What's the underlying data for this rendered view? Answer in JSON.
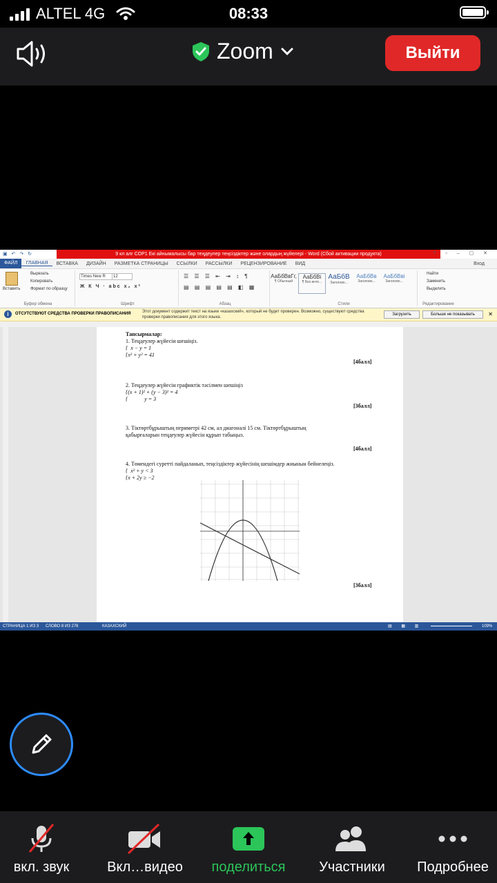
{
  "status": {
    "carrier": "ALTEL 4G",
    "time": "08:33"
  },
  "zoom": {
    "title": "Zoom",
    "leave_label": "Выйти"
  },
  "word": {
    "window_title": "9 кл алг  СОР1 Екі айнымалысы бар теңдеулер теңсіздіктер және олардың жүйелері - Word (Сбой активации продукта)",
    "file_tab": "ФАЙЛ",
    "tabs": [
      "ГЛАВНАЯ",
      "ВСТАВКА",
      "ДИЗАЙН",
      "РАЗМЕТКА СТРАНИЦЫ",
      "ССЫЛКИ",
      "РАССЫЛКИ",
      "РЕЦЕНЗИРОВАНИЕ",
      "ВИД"
    ],
    "login": "Вход",
    "clipboard": {
      "paste": "Вставить",
      "cut": "Вырезать",
      "copy": "Копировать",
      "format": "Формат по образцу",
      "group": "Буфер обмена"
    },
    "font": {
      "name": "Times New R",
      "size": "12",
      "group": "Шрифт"
    },
    "paragraph_group": "Абзац",
    "styles": [
      {
        "sample": "АаБбВвГг,",
        "name": "¶ Обычный"
      },
      {
        "sample": "АаБбВі",
        "name": "¶ Без инте..."
      },
      {
        "sample": "АаБбВ",
        "name": "Заголово..."
      },
      {
        "sample": "АаБбВв",
        "name": "Заголово..."
      },
      {
        "sample": "АаБбВві",
        "name": "Заголово..."
      }
    ],
    "styles_group": "Стили",
    "editing": {
      "find": "Найти",
      "replace": "Заменить",
      "select": "Выделить",
      "group": "Редактирование"
    },
    "infobar": {
      "title": "ОТСУТСТВУЮТ СРЕДСТВА ПРОВЕРКИ ПРАВОПИСАНИЯ",
      "message": "Этот документ содержит текст на языке «казахский», который не будет проверен. Возможно, существуют средства проверки правописания для этого языка.",
      "download": "Загрузить",
      "dont_show": "Больше не показывать"
    },
    "document": {
      "heading": "Тапсырмалар:",
      "q1": "1. Теңдеулер жүйесін шешіңіз.",
      "q1_eq1": "x − y = 1",
      "q1_eq2": "x² + y² = 41",
      "q1_pts": "[4балл]",
      "q2": "2.  Теңдеулер жүйесін графиктік тәсілмен шешіңіз",
      "q2_eq1": "(x + 1)² + (y − 3)² = 4",
      "q2_eq2": "y = 3",
      "q2_pts": "[3балл]",
      "q3_line1": "3.  Тіктөртбұрыштың периметрі 42 см, ал диагоналі 15 см. Тіктөртбұрыштың",
      "q3_line2": "қабырғаларын теңдеулер жүйесін құрып табыңыз.",
      "q3_pts": "[4балл]",
      "q4": "4.  Төмендегі суретті пайдаланып, теңсіздіктер жүйесінің шешімдер жиынын бейнелеңіз.",
      "q4_eq1": "x² + y < 3",
      "q4_eq2": "x + 2y ≥ −2",
      "q4_pts": "[3балл]"
    },
    "statusbar": {
      "page": "СТРАНИЦА 1 ИЗ 3",
      "words": "СЛОВО 8 ИЗ 276",
      "lang": "КАЗАХСКИЙ",
      "zoom": "109%"
    }
  },
  "toolbar": {
    "mute": "вкл. звук",
    "video": "Вкл…видео",
    "share": "поделиться",
    "participants": "Участники",
    "more": "Подробнее"
  },
  "colors": {
    "leave": "#e02828",
    "share_green": "#2cc55a",
    "word_blue": "#2b579a",
    "pen_ring": "#2d8cff"
  }
}
